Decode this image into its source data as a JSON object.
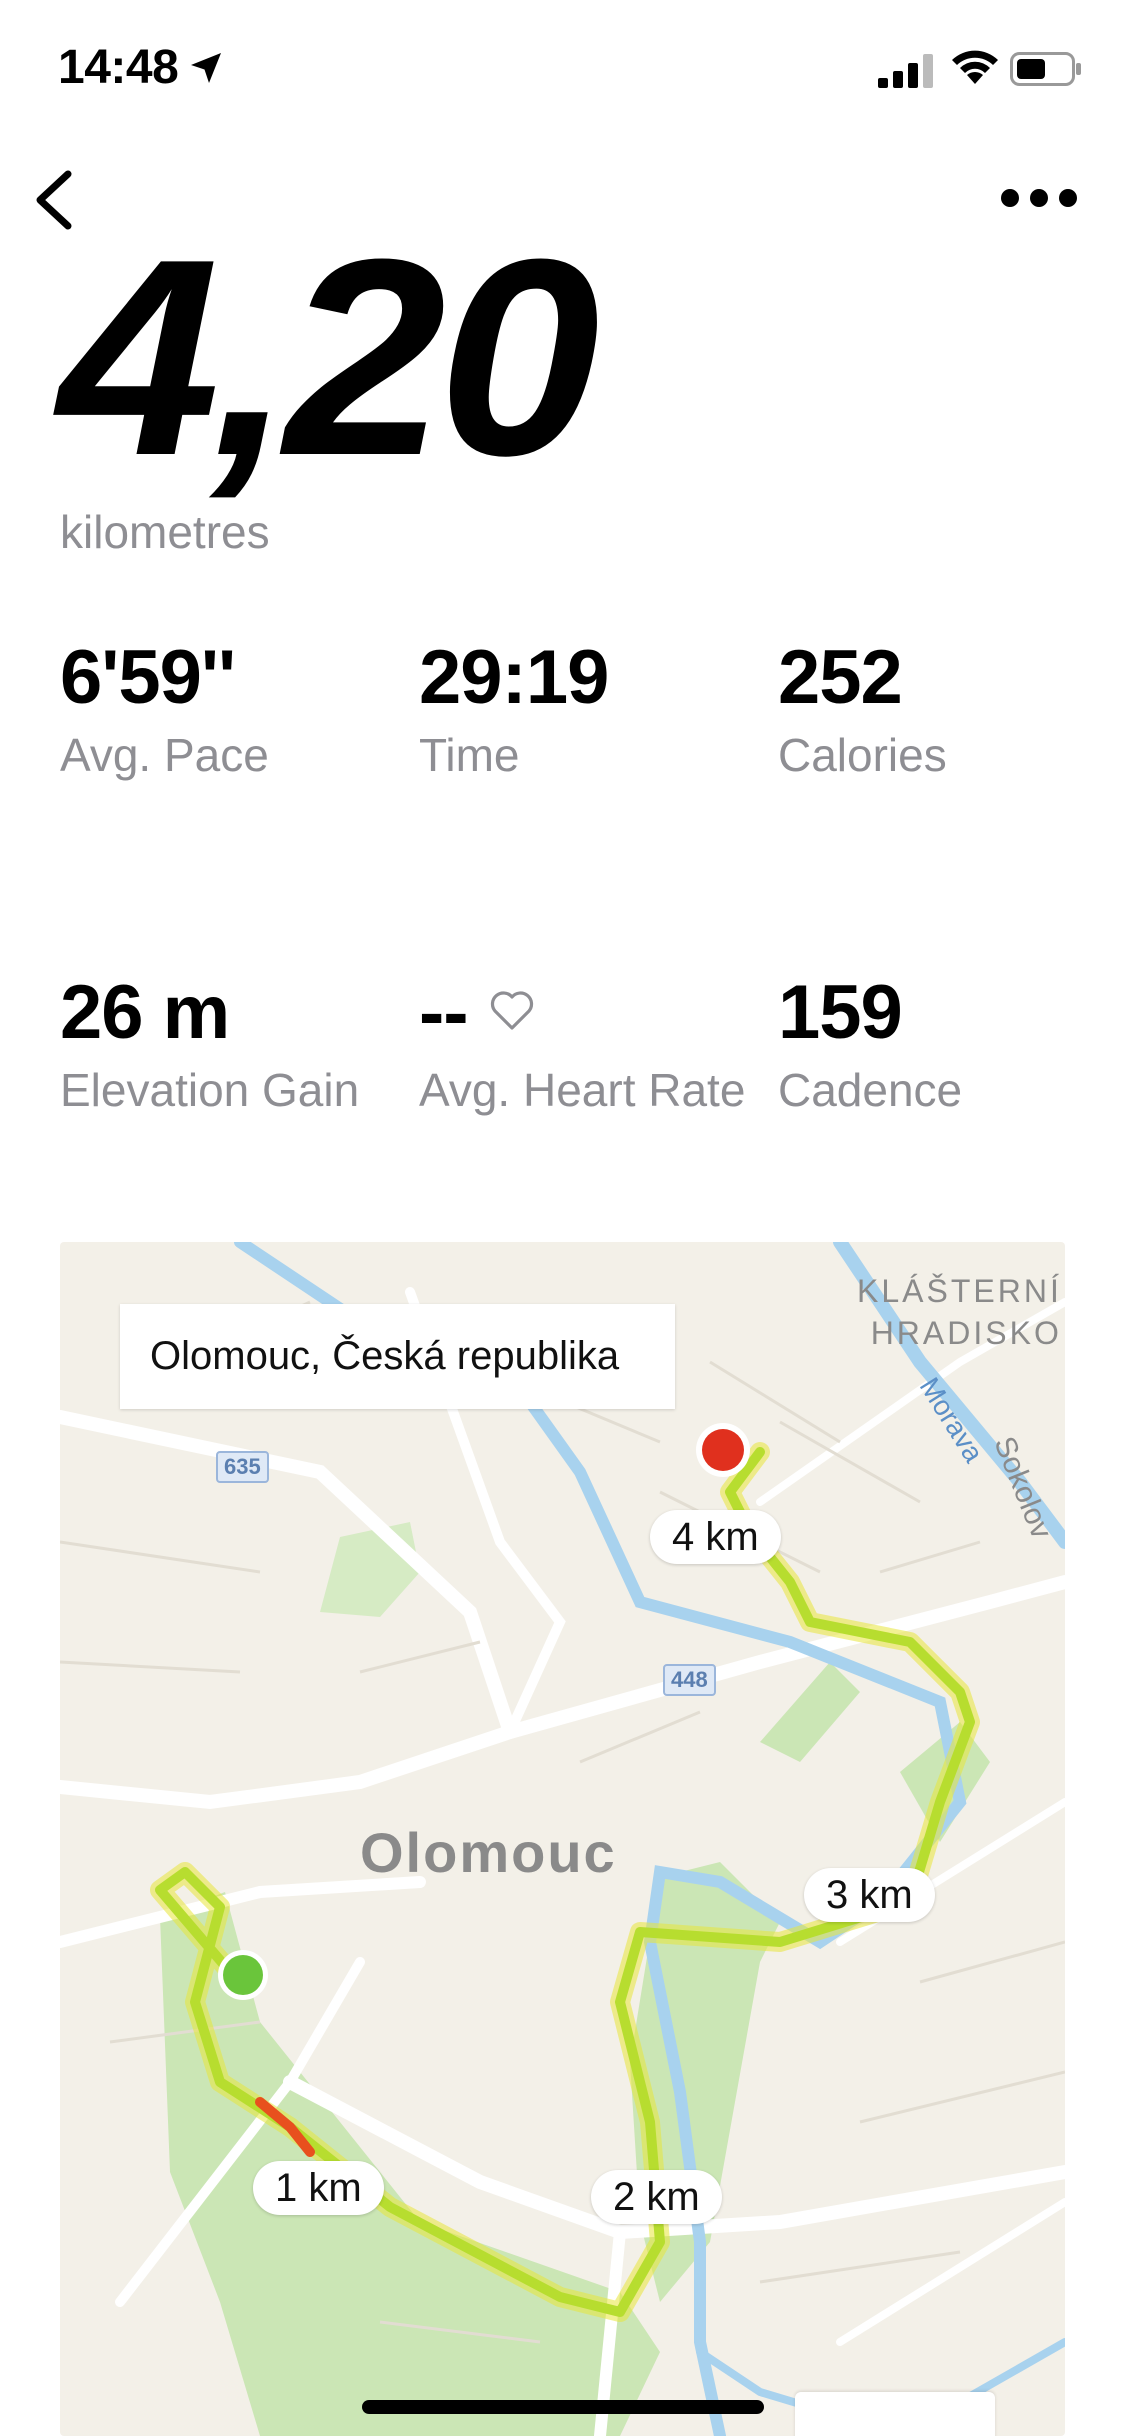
{
  "status_bar": {
    "time": "14:48"
  },
  "summary": {
    "distance": "4,20",
    "distance_unit": "kilometres"
  },
  "stats": [
    {
      "value": "6'59''",
      "label": "Avg. Pace"
    },
    {
      "value": "29:19",
      "label": "Time"
    },
    {
      "value": "252",
      "label": "Calories"
    },
    {
      "value": "26 m",
      "label": "Elevation Gain"
    },
    {
      "value": "--",
      "label": "Avg. Heart Rate"
    },
    {
      "value": "159",
      "label": "Cadence"
    }
  ],
  "map": {
    "location": "Olomouc, Česká republika",
    "city_label": "Olomouc",
    "district_label_1": "KLÁŠTERNÍ",
    "district_label_2": "HRADISKO",
    "river_label": "Morava",
    "street_label": "Sokolov",
    "road_badges": [
      "635",
      "448"
    ],
    "km_markers": [
      "1 km",
      "2 km",
      "3 km",
      "4 km"
    ],
    "colors": {
      "route": "#b7dd2f",
      "route_fast": "#e8501e",
      "start": "#6ac53b",
      "end": "#e0301e",
      "park": "#cbe6b5",
      "water": "#a8d2ee"
    }
  },
  "icons": {
    "back": "chevron-left-icon",
    "more": "ellipsis-icon",
    "heart": "heart-outline-icon",
    "location": "location-arrow-icon",
    "signal": "cellular-signal-icon",
    "wifi": "wifi-icon",
    "battery": "battery-icon"
  }
}
